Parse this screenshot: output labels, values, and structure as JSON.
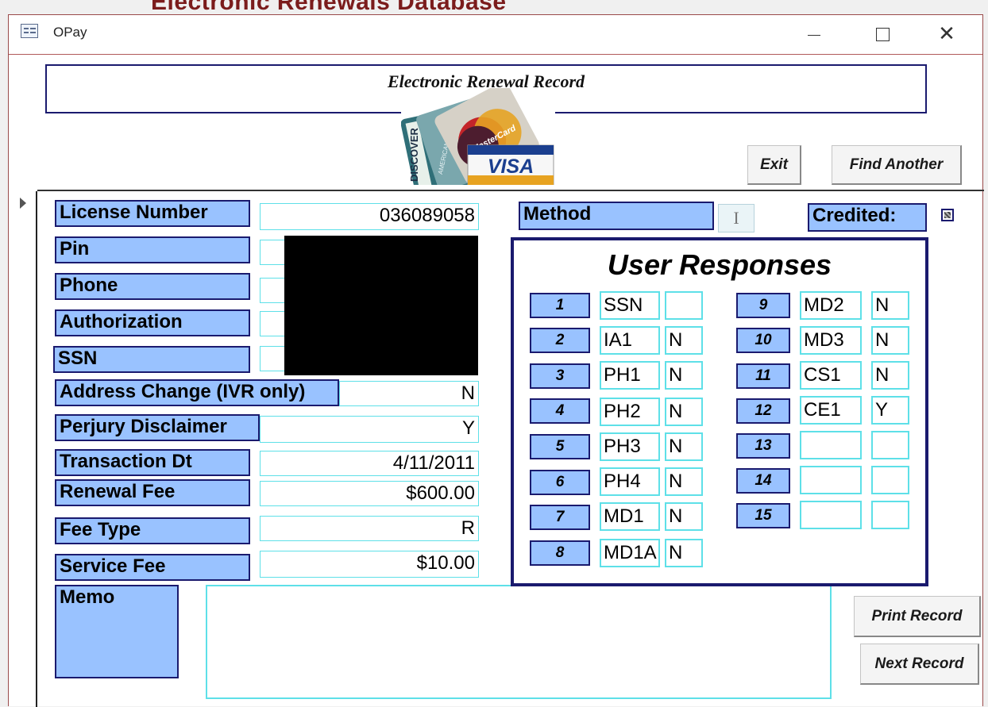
{
  "background_title": "Electronic Renewals Database",
  "window": {
    "title": "OPay",
    "minimize": "—",
    "close": "✕"
  },
  "header": {
    "title": "Electronic Renewal Record",
    "card_brands": [
      "DISCOVER",
      "AMERICAN EXPRESS",
      "MasterCard",
      "VISA"
    ]
  },
  "buttons": {
    "exit": "Exit",
    "find_another": "Find Another",
    "print_record": "Print Record",
    "next_record": "Next Record"
  },
  "fields": {
    "license_number": {
      "label": "License Number",
      "value": "036089058"
    },
    "pin": {
      "label": "Pin",
      "value": ""
    },
    "phone": {
      "label": "Phone",
      "value": ""
    },
    "authorization": {
      "label": "Authorization",
      "value": ""
    },
    "ssn": {
      "label": "SSN",
      "value": ""
    },
    "address_change": {
      "label": "Address Change (IVR only)",
      "value": "N"
    },
    "perjury": {
      "label": "Perjury Disclaimer",
      "value": "Y"
    },
    "transaction_dt": {
      "label": "Transaction Dt",
      "value": "4/11/2011"
    },
    "renewal_fee": {
      "label": "Renewal Fee",
      "value": "$600.00"
    },
    "fee_type": {
      "label": "Fee Type",
      "value": "R"
    },
    "service_fee": {
      "label": "Service Fee",
      "value": "$10.00"
    },
    "memo": {
      "label": "Memo",
      "value": ""
    }
  },
  "method": {
    "label": "Method",
    "value": "I"
  },
  "credited": {
    "label": "Credited:",
    "checked": true
  },
  "user_responses": {
    "title": "User Responses",
    "items": [
      {
        "num": "1",
        "code": "SSN",
        "answer": ""
      },
      {
        "num": "2",
        "code": "IA1",
        "answer": "N"
      },
      {
        "num": "3",
        "code": "PH1",
        "answer": "N"
      },
      {
        "num": "4",
        "code": "PH2",
        "answer": "N"
      },
      {
        "num": "5",
        "code": "PH3",
        "answer": "N"
      },
      {
        "num": "6",
        "code": "PH4",
        "answer": "N"
      },
      {
        "num": "7",
        "code": "MD1",
        "answer": "N"
      },
      {
        "num": "8",
        "code": "MD1A",
        "answer": "N"
      },
      {
        "num": "9",
        "code": "MD2",
        "answer": "N"
      },
      {
        "num": "10",
        "code": "MD3",
        "answer": "N"
      },
      {
        "num": "11",
        "code": "CS1",
        "answer": "N"
      },
      {
        "num": "12",
        "code": "CE1",
        "answer": "Y"
      },
      {
        "num": "13",
        "code": "",
        "answer": ""
      },
      {
        "num": "14",
        "code": "",
        "answer": ""
      },
      {
        "num": "15",
        "code": "",
        "answer": ""
      }
    ]
  },
  "colors": {
    "label_bg": "#99c2ff",
    "label_border": "#1a1a6e",
    "field_border": "#5ee0e8",
    "window_border": "#9a4a4a"
  }
}
